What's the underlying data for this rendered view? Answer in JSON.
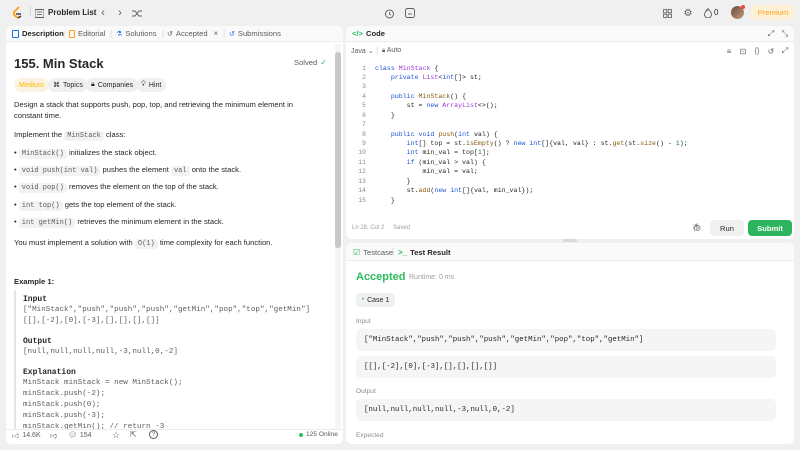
{
  "topbar": {
    "problem_list": "Problem List",
    "coins": "0",
    "premium": "Premium"
  },
  "left_tabs": {
    "description": "Description",
    "editorial": "Editorial",
    "solutions": "Solutions",
    "accepted": "Accepted",
    "submissions": "Submissions"
  },
  "problem": {
    "title": "155. Min Stack",
    "status": "Solved",
    "difficulty": "Medium",
    "topics": "Topics",
    "companies": "Companies",
    "hint": "Hint",
    "intro": "Design a stack that supports push, pop, top, and retrieving the minimum element in constant time.",
    "implement_pre": "Implement the",
    "implement_code": "MinStack",
    "implement_post": "class:",
    "bullets": [
      {
        "code": "MinStack()",
        "text": "initializes the stack object."
      },
      {
        "code": "void push(int val)",
        "text": "pushes the element",
        "code2": "val",
        "text2": "onto the stack."
      },
      {
        "code": "void pop()",
        "text": "removes the element on the top of the stack."
      },
      {
        "code": "int top()",
        "text": "gets the top element of the stack."
      },
      {
        "code": "int getMin()",
        "text": "retrieves the minimum element in the stack."
      }
    ],
    "complexity_pre": "You must implement a solution with",
    "complexity_code": "O(1)",
    "complexity_post": "time complexity for each function.",
    "example_title": "Example 1:",
    "example": {
      "input_label": "Input",
      "input_line1": "[\"MinStack\",\"push\",\"push\",\"push\",\"getMin\",\"pop\",\"top\",\"getMin\"]",
      "input_line2": "[[],[-2],[0],[-3],[],[],[],[]]",
      "output_label": "Output",
      "output_line": "[null,null,null,null,-3,null,0,-2]",
      "explanation_label": "Explanation",
      "exp_lines": [
        "MinStack minStack = new MinStack();",
        "minStack.push(-2);",
        "minStack.push(0);",
        "minStack.push(-3);",
        "minStack.getMin(); // return -3"
      ]
    }
  },
  "left_footer": {
    "likes": "14.6K",
    "comments": "154",
    "online": "125 Online"
  },
  "code_panel": {
    "title": "Code",
    "language": "Java",
    "auto": "Auto",
    "status_pos": "Ln 28, Col 2",
    "status_saved": "Saved",
    "run": "Run",
    "submit": "Submit",
    "line_numbers": [
      "1",
      "2",
      "3",
      "4",
      "5",
      "6",
      "7",
      "8",
      "9",
      "10",
      "11",
      "12",
      "13",
      "14",
      "15"
    ]
  },
  "result_panel": {
    "testcase_tab": "Testcase",
    "result_tab": "Test Result",
    "verdict": "Accepted",
    "runtime": "Runtime: 0 ms",
    "case": "Case 1",
    "input_label": "Input",
    "input_line1": "[\"MinStack\",\"push\",\"push\",\"push\",\"getMin\",\"pop\",\"top\",\"getMin\"]",
    "input_line2": "[[],[-2],[0],[-3],[],[],[],[]]",
    "output_label": "Output",
    "output_value": "[null,null,null,null,-3,null,0,-2]",
    "expected_label": "Expected"
  },
  "colors": {
    "accent_green": "#2db55d",
    "accepted_green": "#2cbb5d",
    "premium_orange": "#ffa116",
    "tab_blue": "#1a73e8"
  }
}
